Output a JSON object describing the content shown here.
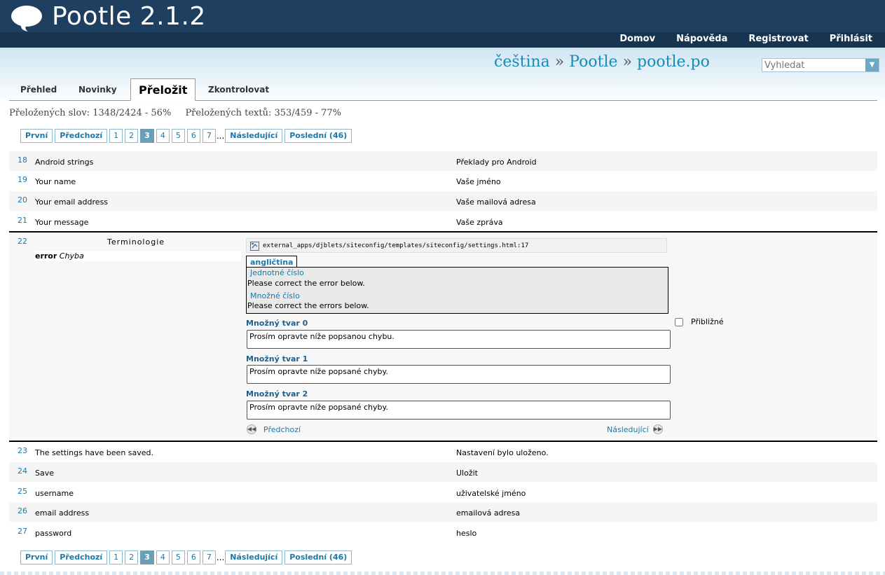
{
  "header": {
    "title": "Pootle 2.1.2",
    "nav": [
      "Domov",
      "Nápověda",
      "Registrovat",
      "Přihlásit"
    ]
  },
  "breadcrumb": {
    "language": "čeština",
    "sep": "»",
    "project": "Pootle",
    "file": "pootle.po"
  },
  "search": {
    "placeholder": "Vyhledat"
  },
  "tabs": [
    "Přehled",
    "Novinky",
    "Přeložit",
    "Zkontrolovat"
  ],
  "stats": {
    "words": "Přeložených slov: 1348/2424 - 56%",
    "strings": "Přeložených textů: 353/459 - 77%"
  },
  "pager": {
    "first": "První",
    "prev": "Předchozí",
    "pages": [
      "1",
      "2",
      "3",
      "4",
      "5",
      "6",
      "7"
    ],
    "current": "3",
    "ellipsis": "...",
    "next": "Následující",
    "last": "Poslední (46)"
  },
  "units_before": [
    {
      "index": "18",
      "source": "Android strings",
      "target": "Překlady pro Android"
    },
    {
      "index": "19",
      "source": "Your name",
      "target": "Vaše jméno"
    },
    {
      "index": "20",
      "source": "Your email address",
      "target": "Vaše mailová adresa"
    },
    {
      "index": "21",
      "source": "Your message",
      "target": "Vaše zpráva"
    }
  ],
  "editor": {
    "index": "22",
    "terminology_heading": "Terminologie",
    "term": {
      "source": "error",
      "target": "Chyba"
    },
    "context_path": "external_apps/djblets/siteconfig/templates/siteconfig/settings.html:17",
    "source_lang": "angličtina",
    "singular_label": "Jednotné číslo",
    "singular_text": "Please correct the error below.",
    "plural_label": "Množné číslo",
    "plural_text": "Please correct the errors below.",
    "forms": [
      {
        "label": "Množný tvar 0",
        "value": "Prosím opravte níže popsanou chybu."
      },
      {
        "label": "Množný tvar 1",
        "value": "Prosím opravte níže popsané chyby."
      },
      {
        "label": "Množný tvar 2",
        "value": "Prosím opravte níže popsané chyby."
      }
    ],
    "fuzzy_label": "Přibližné",
    "prev_label": "Předchozí",
    "next_label": "Následující"
  },
  "units_after": [
    {
      "index": "23",
      "source": "The settings have been saved.",
      "target": "Nastavení bylo uloženo."
    },
    {
      "index": "24",
      "source": "Save",
      "target": "Uložit"
    },
    {
      "index": "25",
      "source": "username",
      "target": "uživatelské jméno"
    },
    {
      "index": "26",
      "source": "email address",
      "target": "emailová adresa"
    },
    {
      "index": "27",
      "source": "password",
      "target": "heslo"
    }
  ],
  "icons": {
    "logo": "speech-bubble-icon",
    "search_go": "arrow-down-icon",
    "context_file": "file-icon",
    "prev": "rewind-icon",
    "next": "fast-forward-icon"
  },
  "colors": {
    "header": "#1e3f5f",
    "link": "#1a78a8",
    "current_page": "#6c9fb7"
  }
}
